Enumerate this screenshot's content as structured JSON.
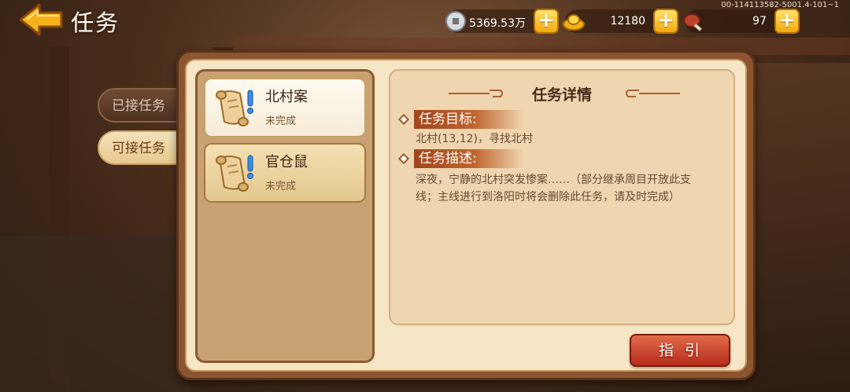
{
  "header": {
    "title": "任务",
    "version": "00-114113582-5001.4-101~1"
  },
  "resources": [
    {
      "name": "silver",
      "icon": "coin-icon",
      "value": "5369.53万"
    },
    {
      "name": "gold",
      "icon": "gold-ingot-icon",
      "value": "12180"
    },
    {
      "name": "stamina",
      "icon": "meat-icon",
      "value": "97"
    }
  ],
  "tabs": [
    {
      "label": "已接任务",
      "active": false
    },
    {
      "label": "可接任务",
      "active": true
    }
  ],
  "quests": [
    {
      "name": "北村案",
      "status": "未完成",
      "selected": true
    },
    {
      "name": "官仓鼠",
      "status": "未完成",
      "selected": false
    }
  ],
  "detail": {
    "title": "任务详情",
    "goal_heading": "任务目标:",
    "goal_text": "北村(13,12)，寻找北村",
    "desc_heading": "任务描述:",
    "desc_text": "深夜，宁静的北村突发惨案……（部分继承周目开放此支线；主线进行到洛阳时将会删除此任务，请及时完成）"
  },
  "guide_button": "指引",
  "colors": {
    "accent_gold": "#f2a90e",
    "guide_red": "#b62d1b",
    "panel_brown": "#8a5530"
  }
}
